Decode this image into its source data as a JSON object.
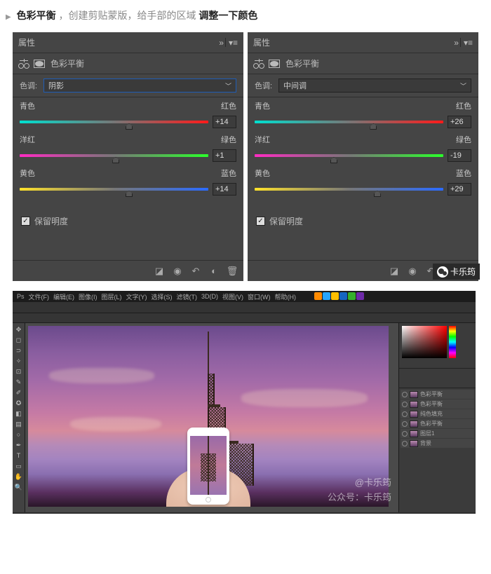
{
  "article": {
    "tri": "▶",
    "bold1": "色彩平衡",
    "gray1": "，创建剪贴蒙版，给手部的区域",
    "bold2": "调整一下颜色"
  },
  "panels": [
    {
      "tab": "属性",
      "flyout": "»",
      "title": "色彩平衡",
      "tone_label": "色调:",
      "tone_value": "阴影",
      "tone_focused": true,
      "sliders": [
        {
          "left": "青色",
          "right": "红色",
          "value": "+14",
          "grad": "grad-cr",
          "pos": 58
        },
        {
          "left": "洋红",
          "right": "绿色",
          "value": "+1",
          "grad": "grad-mg",
          "pos": 51
        },
        {
          "left": "黄色",
          "right": "蓝色",
          "value": "+14",
          "grad": "grad-yb",
          "pos": 58
        }
      ],
      "preserve_label": "保留明度",
      "preserve_checked": true
    },
    {
      "tab": "属性",
      "flyout": "»",
      "title": "色彩平衡",
      "tone_label": "色调:",
      "tone_value": "中间调",
      "tone_focused": false,
      "sliders": [
        {
          "left": "青色",
          "right": "红色",
          "value": "+26",
          "grad": "grad-cr",
          "pos": 63
        },
        {
          "left": "洋红",
          "right": "绿色",
          "value": "-19",
          "grad": "grad-mg",
          "pos": 42
        },
        {
          "left": "黄色",
          "right": "蓝色",
          "value": "+29",
          "grad": "grad-yb",
          "pos": 65
        }
      ],
      "preserve_label": "保留明度",
      "preserve_checked": true
    }
  ],
  "footer_icons": [
    "clip-mask-icon",
    "view-previous-icon",
    "reset-icon",
    "toggle-visibility-icon",
    "delete-icon"
  ],
  "wechat_badge": "卡乐筠",
  "ps": {
    "menus": [
      "Ps",
      "文件(F)",
      "编辑(E)",
      "图像(I)",
      "图层(L)",
      "文字(Y)",
      "选择(S)",
      "滤镜(T)",
      "3D(D)",
      "视图(V)",
      "窗口(W)",
      "帮助(H)"
    ],
    "watermark_line1": "@卡乐筠",
    "watermark_line2": "公众号：卡乐筠",
    "layers": [
      "色彩平衡",
      "色彩平衡",
      "纯色填充",
      "色彩平衡",
      "图层1",
      "背景"
    ]
  }
}
